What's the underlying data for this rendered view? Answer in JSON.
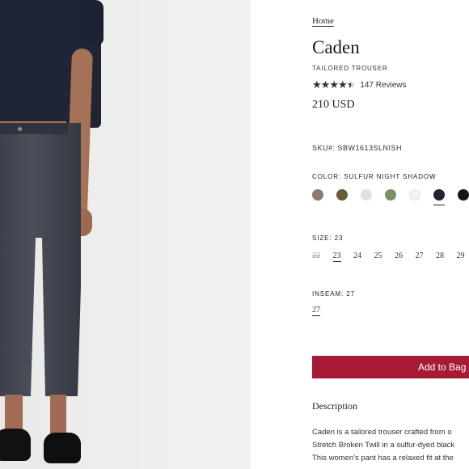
{
  "breadcrumb": "Home",
  "product": {
    "name": "Caden",
    "subtitle": "TAILORED TROUSER",
    "rating": 4.5,
    "stars": "★★★★★",
    "reviews": "147 Reviews",
    "price": "210 USD",
    "sku": "SKU#: SBW1613SLNISH"
  },
  "color": {
    "label": "COLOR: SULFUR NIGHT SHADOW",
    "swatches": [
      "#877c6e",
      "#6a5a36",
      "#e5e0d6",
      "#7e8f63",
      "#f2f2f2",
      "#1f2536",
      "#161616"
    ],
    "selected_index": 5
  },
  "size": {
    "label": "SIZE: 23",
    "options": [
      "22",
      "23",
      "24",
      "25",
      "26",
      "27",
      "28",
      "29"
    ],
    "disabled": [
      "22"
    ],
    "selected": "23"
  },
  "inseam": {
    "label": "INSEAM: 27",
    "value": "27"
  },
  "cart": {
    "button_label": "Add to Bag"
  },
  "description": {
    "heading": "Description",
    "lines": [
      "Caden is a tailored trouser crafted from o",
      "Stretch Broken Twill in a sulfur-dyed black",
      "This women's pant has a relaxed fit at the"
    ]
  },
  "colors": {
    "accent": "#a51a34"
  }
}
